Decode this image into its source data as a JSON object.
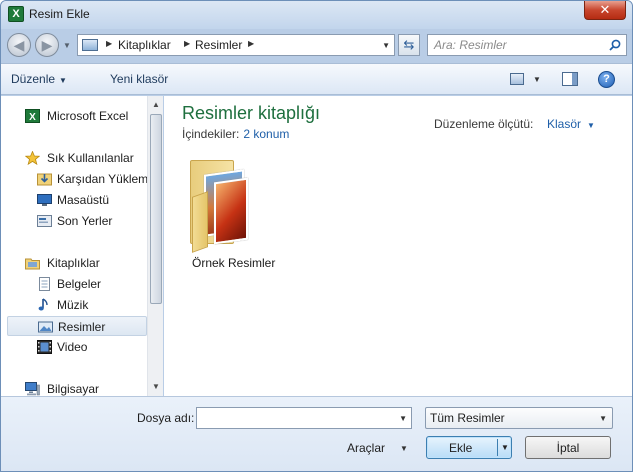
{
  "window": {
    "title": "Resim Ekle",
    "close_glyph": "✕",
    "app_icon_letter": "X"
  },
  "address": {
    "parts": [
      "Kitaplıklar",
      "Resimler"
    ],
    "search_placeholder": "Ara: Resimler"
  },
  "toolbar": {
    "organize_label": "Düzenle",
    "new_folder_label": "Yeni klasör"
  },
  "sidebar": {
    "items": [
      {
        "label": "Microsoft Excel",
        "icon": "excel-icon"
      },
      {
        "label": "Sık Kullanılanlar",
        "icon": "star-icon"
      },
      {
        "label": "Karşıdan Yüklem",
        "icon": "downloads-icon"
      },
      {
        "label": "Masaüstü",
        "icon": "desktop-icon"
      },
      {
        "label": "Son Yerler",
        "icon": "recent-places-icon"
      },
      {
        "label": "Kitaplıklar",
        "icon": "libraries-icon"
      },
      {
        "label": "Belgeler",
        "icon": "documents-icon"
      },
      {
        "label": "Müzik",
        "icon": "music-icon"
      },
      {
        "label": "Resimler",
        "icon": "pictures-icon",
        "selected": true
      },
      {
        "label": "Video",
        "icon": "video-icon"
      },
      {
        "label": "Bilgisayar",
        "icon": "computer-icon"
      }
    ]
  },
  "main": {
    "library_title": "Resimler kitaplığı",
    "includes_label": "İçindekiler:",
    "includes_count": "2 konum",
    "arrange_label": "Düzenleme ölçütü:",
    "arrange_value": "Klasör",
    "items": [
      {
        "label": "Örnek Resimler",
        "icon": "picture-folder-icon"
      }
    ]
  },
  "footer": {
    "filename_label": "Dosya adı:",
    "filename_value": "",
    "filetype_value": "Tüm Resimler",
    "tools_label": "Araçlar",
    "insert_label": "Ekle",
    "cancel_label": "İptal"
  },
  "colors": {
    "accent": "#1e6f3e",
    "link": "#1f5fa8",
    "close": "#c8462e"
  }
}
